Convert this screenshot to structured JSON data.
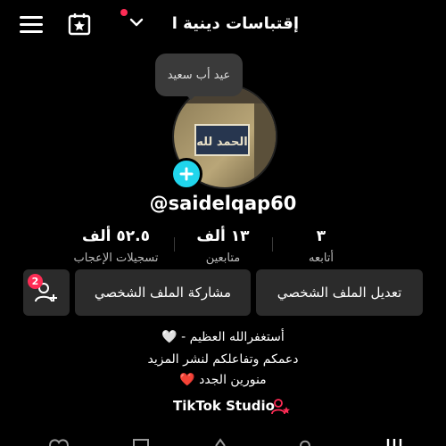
{
  "header": {
    "title": "إقتباسات دينية ا",
    "menu_icon": "menu-icon",
    "calendar_icon": "calendar-star-icon",
    "chevron_icon": "chevron-down-icon",
    "notification_color": "#fe2c55"
  },
  "bubble": {
    "text": "عيد أب سعيد"
  },
  "avatar": {
    "image_text": "الحمد لله",
    "add_color": "#20d5ec"
  },
  "profile": {
    "username": "@saidelqap60"
  },
  "stats": [
    {
      "value": "٣",
      "label": "أتابعه"
    },
    {
      "value": "١٣ ألف",
      "label": "متابعين"
    },
    {
      "value": "٥٢.٥ ألف",
      "label": "تسجيلات الإعجاب"
    }
  ],
  "buttons": {
    "edit_profile": "تعديل الملف الشخصي",
    "share_profile": "مشاركة الملف الشخصي",
    "add_friends_badge": "2"
  },
  "bio": {
    "line1": "أستغفرالله العظيم - 🤍",
    "line2": "دعمكم وتفاعلكم لنشر المزيد",
    "line3": "منورين الجدد ❤️"
  },
  "studio": {
    "label": "TikTok Studio",
    "icon": "person-star-icon"
  }
}
